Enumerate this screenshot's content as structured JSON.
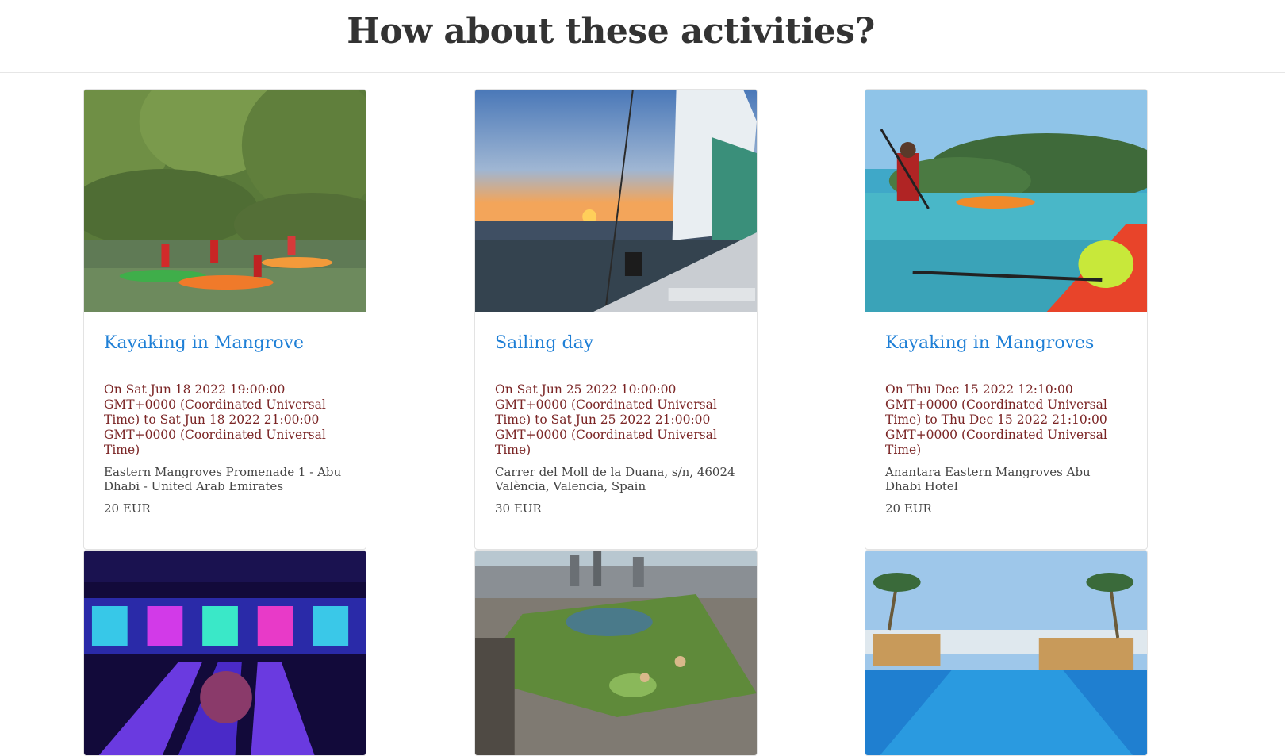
{
  "page": {
    "title": "How about these activities?"
  },
  "activities": [
    {
      "title": "Kayaking in Mangrove",
      "dates": "On Sat Jun 18 2022 19:00:00 GMT+0000 (Coordinated Universal Time) to Sat Jun 18 2022 21:00:00 GMT+0000 (Coordinated Universal Time)",
      "address": "Eastern Mangroves Promenade 1 - Abu Dhabi - United Arab Emirates",
      "price": "20 EUR",
      "image": "kayaking-mangrove-photo"
    },
    {
      "title": "Sailing day",
      "dates": "On Sat Jun 25 2022 10:00:00 GMT+0000 (Coordinated Universal Time) to Sat Jun 25 2022 21:00:00 GMT+0000 (Coordinated Universal Time)",
      "address": "Carrer del Moll de la Duana, s/n, 46024 València, Valencia, Spain",
      "price": "30 EUR",
      "image": "sailing-sunset-photo"
    },
    {
      "title": "Kayaking in Mangroves",
      "dates": "On Thu Dec 15 2022 12:10:00 GMT+0000 (Coordinated Universal Time) to Thu Dec 15 2022 21:10:00 GMT+0000 (Coordinated Universal Time)",
      "address": "Anantara Eastern Mangroves Abu Dhabi Hotel",
      "price": "20 EUR",
      "image": "kayaking-lagoon-photo"
    },
    {
      "image": "bowling-alley-photo"
    },
    {
      "image": "central-park-aerial-photo"
    },
    {
      "image": "infinity-pool-photo"
    }
  ],
  "colors": {
    "title_link": "#1e7fd6",
    "dates_text": "#7a2424",
    "body_text": "#444444",
    "heading": "#333333"
  }
}
